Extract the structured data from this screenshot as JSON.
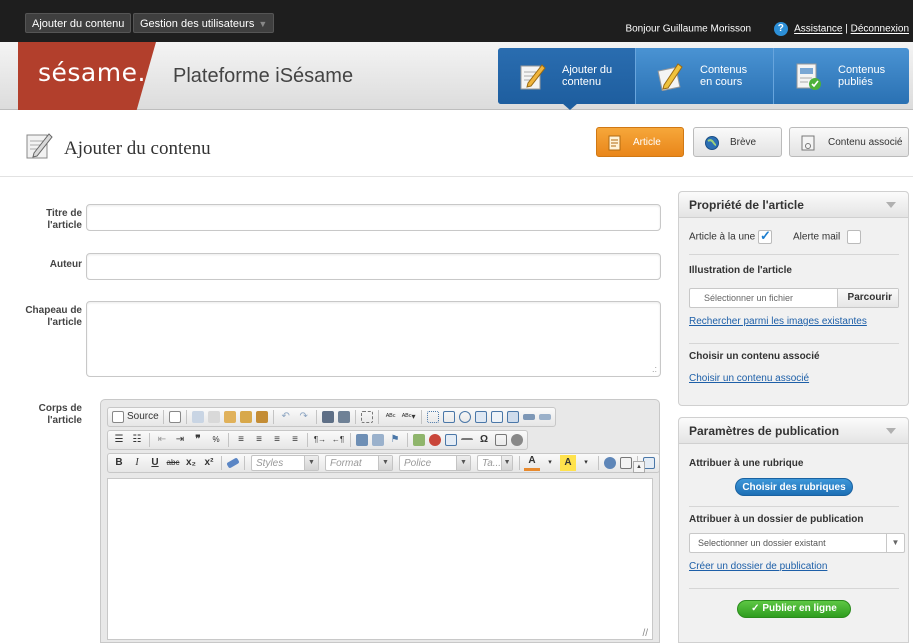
{
  "topbar": {
    "menu_add": "Ajouter du contenu",
    "menu_users": "Gestion des utilisateurs",
    "greeting": "Bonjour Guillaume Morisson",
    "assistance": "Assistance",
    "separator": "|",
    "logout": "Déconnexion"
  },
  "header": {
    "logo": "sésame.",
    "platform_title": "Plateforme iSésame",
    "nav": [
      {
        "line1": "Ajouter du",
        "line2": "contenu",
        "icon": "edit-document-icon"
      },
      {
        "line1": "Contenus",
        "line2": "en cours",
        "icon": "pencil-document-icon"
      },
      {
        "line1": "Contenus",
        "line2": "publiés",
        "icon": "published-document-icon"
      }
    ]
  },
  "page": {
    "title": "Ajouter du contenu",
    "type_buttons": {
      "article": "Article",
      "breve": "Brève",
      "associated": "Contenu associé"
    }
  },
  "form": {
    "title_label_1": "Titre de",
    "title_label_2": "l'article",
    "author_label": "Auteur",
    "lead_label_1": "Chapeau de",
    "lead_label_2": "l'article",
    "body_label_1": "Corps de",
    "body_label_2": "l'article"
  },
  "editor": {
    "source": "Source",
    "styles": "Styles",
    "format": "Format",
    "font": "Police",
    "size": "Ta..."
  },
  "article_panel": {
    "title": "Propriété de l'article",
    "featured": "Article à la une",
    "featured_checked": true,
    "mail_alert": "Alerte mail",
    "mail_alert_checked": false,
    "illustration_label": "Illustration de l'article",
    "file_placeholder": "Sélectionner un fichier",
    "browse": "Parcourir",
    "search_images": "Rechercher parmi les images existantes",
    "assoc_label": "Choisir un contenu associé",
    "assoc_link": "Choisir un contenu associé"
  },
  "publication_panel": {
    "title": "Paramètres de publication",
    "rubric_label": "Attribuer à une rubrique",
    "rubric_button": "Choisir des rubriques",
    "folder_label": "Attribuer à un dossier de publication",
    "folder_select": "Selectionner un dossier existant",
    "create_folder": "Créer un dossier de publication",
    "publish_button": "Publier en ligne"
  },
  "colors": {
    "topbar": "#1e1e1e",
    "brand_red": "#b23f2c",
    "nav_blue": "#2a71b3",
    "article_orange": "#e9861a",
    "publish_green": "#2f9d1f"
  }
}
